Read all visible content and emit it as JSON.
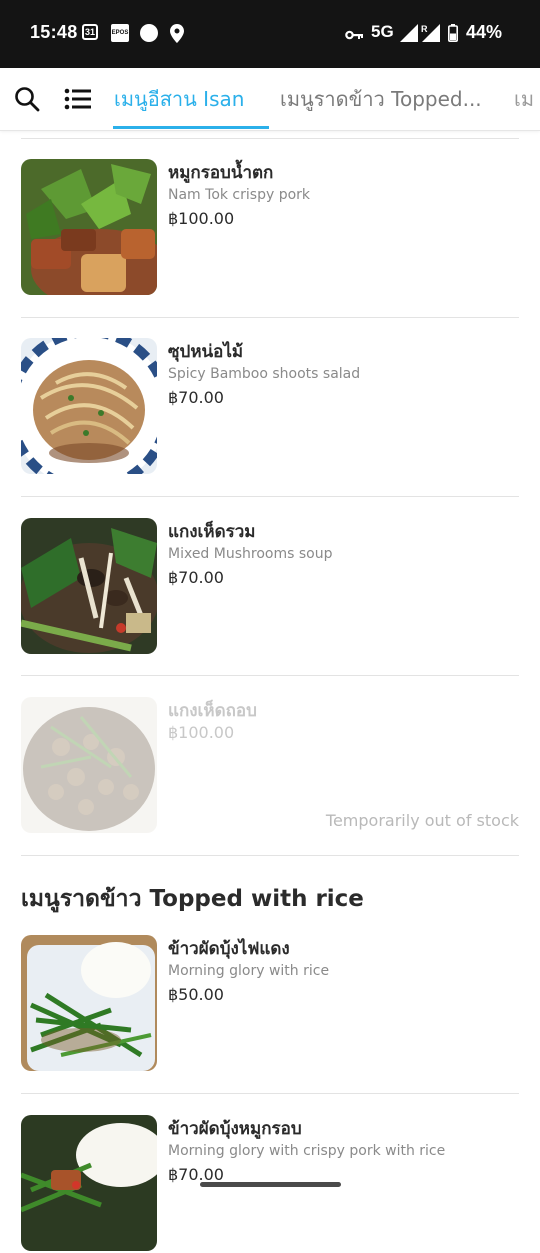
{
  "status_bar": {
    "time": "15:48",
    "calendar_day": "31",
    "epos": "EPOS",
    "network": "5G",
    "roaming": "R",
    "battery": "44%"
  },
  "icons": {
    "search": "search-icon",
    "menu": "list-menu-icon"
  },
  "tabs": [
    {
      "label": "เมนูอีสาน Isan",
      "active": true
    },
    {
      "label": "เมนูราดข้าว Topped...",
      "active": false
    },
    {
      "label": "เม",
      "active": false
    }
  ],
  "items": [
    {
      "name": "หมูกรอบน้ำตก",
      "desc": "Nam Tok crispy pork",
      "price": "฿100.00"
    },
    {
      "name": "ซุปหน่อไม้",
      "desc": "Spicy Bamboo shoots salad",
      "price": "฿70.00"
    },
    {
      "name": "แกงเห็ดรวม",
      "desc": "Mixed Mushrooms soup",
      "price": "฿70.00"
    },
    {
      "name": "แกงเห็ดถอบ",
      "desc": "",
      "price": "฿100.00",
      "status": "Temporarily out of stock"
    }
  ],
  "section2": {
    "title": "เมนูราดข้าว Topped with rice",
    "items": [
      {
        "name": "ข้าวผัดบุ้งไฟแดง",
        "desc": "Morning glory with rice",
        "price": "฿50.00"
      },
      {
        "name": "ข้าวผัดบุ้งหมูกรอบ",
        "desc": "Morning glory with crispy pork with rice",
        "price": "฿70.00"
      }
    ]
  },
  "colors": {
    "accent": "#2bb0ea",
    "text": "#2b2b2b",
    "muted": "#8a8a8a",
    "status_bar_bg": "#141414"
  }
}
